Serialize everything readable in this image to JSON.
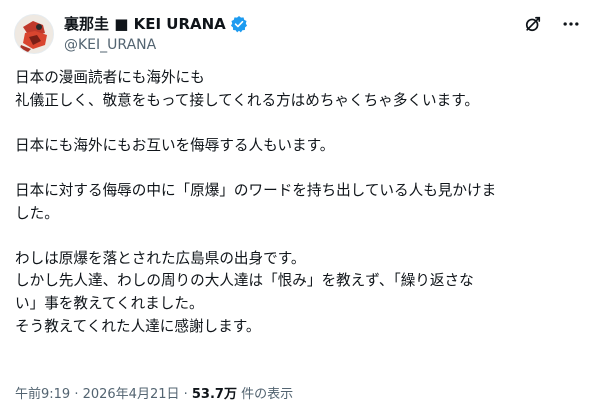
{
  "author": {
    "display_name": "裏那圭 ■ KEI URANA",
    "handle": "@KEI_URANA",
    "verified": true,
    "avatar_icon": "author-avatar",
    "verified_icon": "verified-badge-icon",
    "verified_color": "#1d9bf0"
  },
  "actions": {
    "grok_icon": "grok-icon",
    "more_icon": "more-options-icon"
  },
  "content": {
    "paragraphs": [
      {
        "lines": [
          "日本の漫画読者にも海外にも",
          "礼儀正しく、敬意をもって接してくれる方はめちゃくちゃ多くいます。"
        ]
      },
      {
        "lines": [
          "日本にも海外にもお互いを侮辱する人もいます。"
        ]
      },
      {
        "lines": [
          "日本に対する侮辱の中に「原爆」のワードを持ち出している人も見かけま",
          "した。"
        ]
      },
      {
        "lines": [
          "わしは原爆を落とされた広島県の出身です。",
          "しかし先人達、わしの周りの大人達は「恨み」を教えず、「繰り返さな",
          "い」事を教えてくれました。",
          "そう教えてくれた人達に感謝します。"
        ]
      }
    ]
  },
  "meta": {
    "timestamp": "午前9:19 · 2026年4月21日 · ",
    "views_count": "53.7万",
    "views_label": " 件の表示"
  },
  "colors": {
    "text": "#0f1419",
    "secondary": "#536471",
    "accent": "#1d9bf0"
  }
}
